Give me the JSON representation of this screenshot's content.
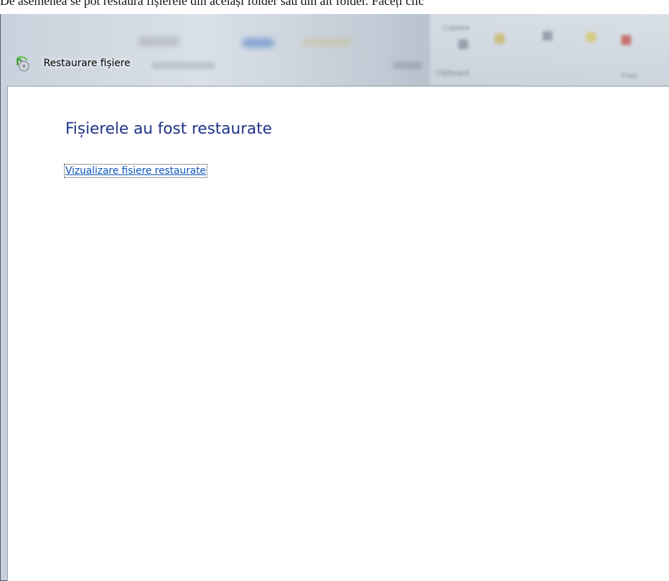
{
  "background_text": "De asemenea se pot restaura fișierele din același folder sau din alt folder. Faceți clic",
  "window": {
    "title": "Restaurare fișiere"
  },
  "ribbon_blurred": {
    "group_clipboard": "Clipboard",
    "copy_label": "Copiere",
    "group_font": "Font"
  },
  "content": {
    "heading": "Fișierele au fost restaurate",
    "link": "Vizualizare fisiere restaurate"
  }
}
